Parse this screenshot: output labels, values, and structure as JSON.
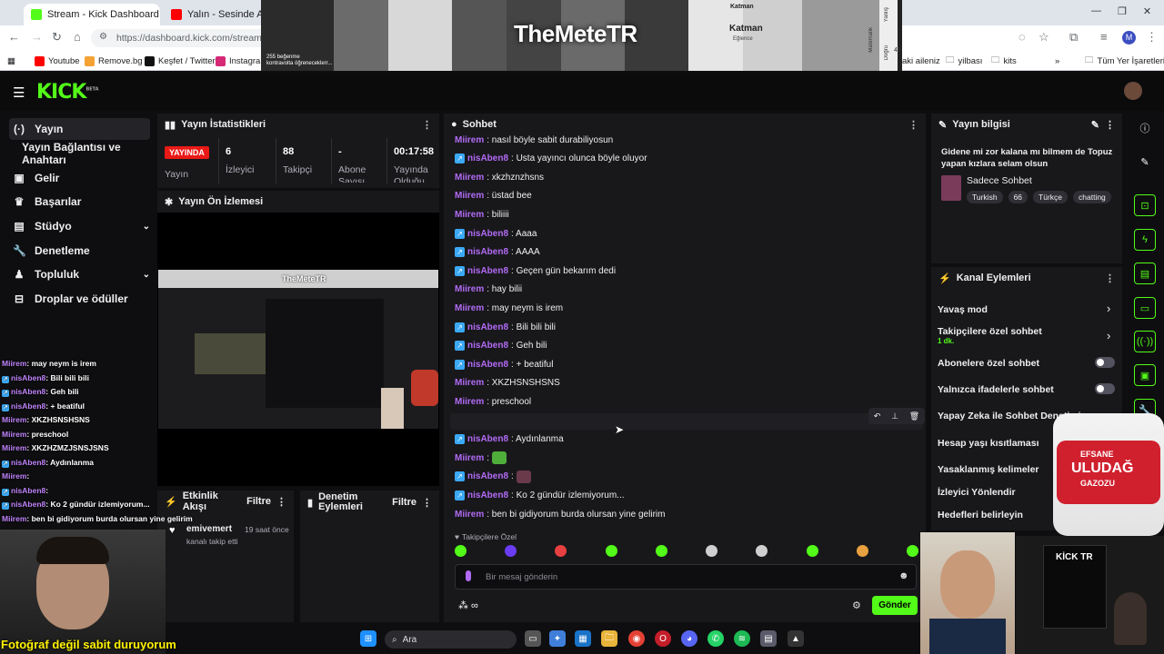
{
  "browser": {
    "tabs": [
      {
        "title": "Stream - Kick Dashboard",
        "active": true
      },
      {
        "title": "Yalın - Sesinde Aşk Var",
        "active": false
      }
    ],
    "url": "https://dashboard.kick.com/stream",
    "profile_initial": "M",
    "bookmarks": [
      "Youtube",
      "Remove.bg",
      "Keşfet / Twitter",
      "Instagram",
      "aki aileniz",
      "yilbası",
      "kits",
      "Tüm Yer İşaretleri"
    ]
  },
  "banner": {
    "title": "TheMeteTR",
    "tile_caption_1": "255 beğenme",
    "tile_caption_2": "kontravolta öğreneceklerr...",
    "katman": "Katman",
    "katman_sub": "Eğlence",
    "side_text": "Yanlış",
    "side_text_2": "Doğru",
    "side_text_3": "Matematik",
    "side_num": "40"
  },
  "kick": {
    "logo": "KICK",
    "logo_sup": "BETA"
  },
  "sidebar": {
    "items": [
      {
        "label": "Yayın",
        "icon": "broadcast-icon"
      },
      {
        "label": "Yayın Bağlantısı ve Anahtarı",
        "icon": ""
      },
      {
        "label": "Gelir",
        "icon": "revenue-icon"
      },
      {
        "label": "Başarılar",
        "icon": "trophy-icon"
      },
      {
        "label": "Stüdyo",
        "icon": "studio-icon"
      },
      {
        "label": "Denetleme",
        "icon": "wrench-icon"
      },
      {
        "label": "Topluluk",
        "icon": "community-icon"
      },
      {
        "label": "Droplar ve ödüller",
        "icon": "drops-icon"
      }
    ]
  },
  "stats": {
    "title": "Yayın İstatistikleri",
    "live_badge": "YAYINDA",
    "live_label": "Yayın",
    "viewers": "6",
    "viewers_label": "İzleyici",
    "followers": "88",
    "followers_label": "Takipçi",
    "subs": "-",
    "subs_label": "Abone Sayısı",
    "uptime": "00:17:58",
    "uptime_label": "Yayında Olduğu"
  },
  "preview": {
    "title": "Yayın Ön İzlemesi",
    "mini_title": "TheMeteTR"
  },
  "activity": {
    "title": "Etkinlik Akışı",
    "filter": "Filtre",
    "user": "emivemert",
    "time": "19 saat önce",
    "action": "kanalı takip etti"
  },
  "moderation": {
    "title": "Denetim Eylemleri",
    "filter": "Filtre"
  },
  "chat": {
    "title": "Sohbet",
    "messages": [
      {
        "user": "Miirem",
        "text": ": nasıl böyle sabit durabiliyosun",
        "badge": false,
        "color": "#b26bf5"
      },
      {
        "user": "nisAben8",
        "text": ": Usta yayıncı olunca böyle oluyor",
        "badge": true,
        "color": "#b26bf5"
      },
      {
        "user": "Miirem",
        "text": ": xkzhznzhsns",
        "badge": false,
        "color": "#b26bf5"
      },
      {
        "user": "Miirem",
        "text": ": üstad bee",
        "badge": false,
        "color": "#b26bf5"
      },
      {
        "user": "Miirem",
        "text": ": biliiii",
        "badge": false,
        "color": "#b26bf5"
      },
      {
        "user": "nisAben8",
        "text": ": Aaaa",
        "badge": true,
        "color": "#b26bf5"
      },
      {
        "user": "nisAben8",
        "text": ": AAAA",
        "badge": true,
        "color": "#b26bf5"
      },
      {
        "user": "nisAben8",
        "text": ": Geçen gün bekarım dedi",
        "badge": true,
        "color": "#b26bf5"
      },
      {
        "user": "Miirem",
        "text": ": hay bilii",
        "badge": false,
        "color": "#b26bf5"
      },
      {
        "user": "Miirem",
        "text": ": may neym is irem",
        "badge": false,
        "color": "#b26bf5"
      },
      {
        "user": "nisAben8",
        "text": ": Bili bili bili",
        "badge": true,
        "color": "#b26bf5"
      },
      {
        "user": "nisAben8",
        "text": ": Geh bili",
        "badge": true,
        "color": "#b26bf5"
      },
      {
        "user": "nisAben8",
        "text": ": + beatiful",
        "badge": true,
        "color": "#b26bf5"
      },
      {
        "user": "Miirem",
        "text": ": XKZHSNSHSNS",
        "badge": false,
        "color": "#b26bf5"
      },
      {
        "user": "Miirem",
        "text": ": preschool",
        "badge": false,
        "color": "#b26bf5"
      },
      {
        "user": "Miirem",
        "text": ": XKZHZMZJSNSJSNS",
        "badge": false,
        "color": "#b26bf5"
      },
      {
        "user": "nisAben8",
        "text": ": Aydınlanma",
        "badge": true,
        "color": "#b26bf5"
      },
      {
        "user": "Miirem",
        "text": ":",
        "badge": false,
        "color": "#b26bf5",
        "emote": "green"
      },
      {
        "user": "nisAben8",
        "text": ":",
        "badge": true,
        "color": "#b26bf5",
        "emote": "pink"
      },
      {
        "user": "nisAben8",
        "text": ": Ko 2 gündür izlemiyorum...",
        "badge": true,
        "color": "#b26bf5"
      },
      {
        "user": "Miirem",
        "text": ": ben bi gidiyorum burda olursan yine gelirim",
        "badge": false,
        "color": "#b26bf5"
      }
    ],
    "followers_only": "Takipçilere Özel",
    "input_placeholder": "Bir mesaj gönderin",
    "send": "Gönder"
  },
  "stream_info": {
    "title": "Yayın bilgisi",
    "stream_title": "Gidene mi zor kalana mı bilmem de Topuz yapan kızlara selam olsun",
    "category": "Sadece Sohbet",
    "tags": [
      "Turkish",
      "66",
      "Türkçe",
      "chatting"
    ]
  },
  "channel_actions": {
    "title": "Kanal Eylemleri",
    "slow_mode": "Yavaş mod",
    "followers_chat": "Takipçilere özel sohbet",
    "followers_chat_sub": "1 dk.",
    "subs_chat": "Abonelere özel sohbet",
    "emote_chat": "Yalnızca ifadelerle sohbet",
    "ai_mod": "Yapay Zeka ile Sohbet Denetimi",
    "age_limit": "Hesap yaşı kısıtlaması",
    "banned_words": "Yasaklanmış kelimeler",
    "viewer_redirect": "İzleyici Yönlendir",
    "goals": "Hedefleri belirleyin"
  },
  "overlay": {
    "chat": [
      {
        "user": "Miirem",
        "text": ": may neym is irem"
      },
      {
        "user": "nisAben8",
        "text": ": Bili bili bili"
      },
      {
        "user": "nisAben8",
        "text": ": Geh bili"
      },
      {
        "user": "nisAben8",
        "text": ": + beatiful"
      },
      {
        "user": "Miirem",
        "text": ": XKZHSNSHSNS"
      },
      {
        "user": "Miirem",
        "text": ": preschool"
      },
      {
        "user": "Miirem",
        "text": ": XKZHZMZJSNSJSNS"
      },
      {
        "user": "nisAben8",
        "text": ": Aydınlanma"
      },
      {
        "user": "Miirem",
        "text": ":"
      },
      {
        "user": "nisAben8",
        "text": ":"
      },
      {
        "user": "nisAben8",
        "text": ": Ko 2 gündür izlemiyorum..."
      },
      {
        "user": "Miirem",
        "text": ": ben bi gidiyorum burda olursan yine gelirim"
      }
    ],
    "caption": "Fotoğraf değil sabit duruyorum",
    "bottle_line1": "EFSANE",
    "bottle_line2": "ULUDAĞ",
    "bottle_line3": "GAZOZU",
    "kick_tr": "KİCK TR"
  },
  "taskbar": {
    "search": "Ara"
  },
  "colors": {
    "kick_green": "#53fc18",
    "panel": "#18181b",
    "bg": "#0e0e10",
    "username": "#b26bf5",
    "live_red": "#e91916"
  }
}
